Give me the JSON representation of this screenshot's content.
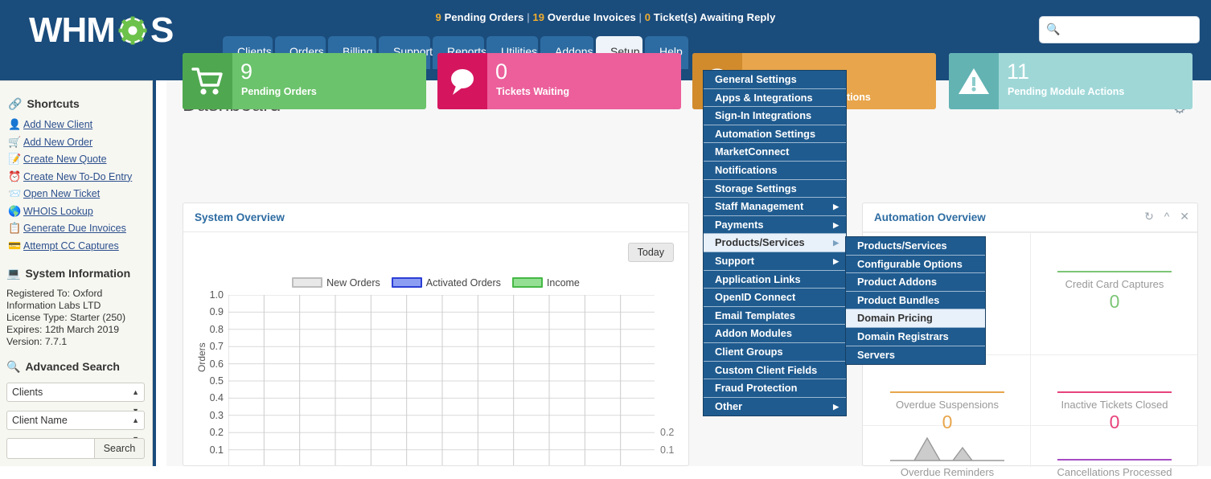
{
  "header": {
    "logo_text": "WHM",
    "logo_text2": "S",
    "notifications": {
      "pending_orders_count": "9",
      "pending_orders_label": "Pending Orders",
      "overdue_invoices_count": "19",
      "overdue_invoices_label": "Overdue Invoices",
      "tickets_count": "0",
      "tickets_label": "Ticket(s) Awaiting Reply",
      "separator": "|"
    },
    "search_placeholder": "",
    "search_value": ""
  },
  "nav": {
    "tabs": [
      {
        "label": "Clients",
        "active": false
      },
      {
        "label": "Orders",
        "active": false
      },
      {
        "label": "Billing",
        "active": false
      },
      {
        "label": "Support",
        "active": false
      },
      {
        "label": "Reports",
        "active": false
      },
      {
        "label": "Utilities",
        "active": false
      },
      {
        "label": "Addons",
        "active": false
      },
      {
        "label": "Setup",
        "active": true
      },
      {
        "label": "Help",
        "active": false
      }
    ]
  },
  "setup_menu": {
    "items": [
      {
        "label": "General Settings",
        "has_submenu": false,
        "hover": false
      },
      {
        "label": "Apps & Integrations",
        "has_submenu": false,
        "hover": false
      },
      {
        "label": "Sign-In Integrations",
        "has_submenu": false,
        "hover": false
      },
      {
        "label": "Automation Settings",
        "has_submenu": false,
        "hover": false
      },
      {
        "label": "MarketConnect",
        "has_submenu": false,
        "hover": false
      },
      {
        "label": "Notifications",
        "has_submenu": false,
        "hover": false
      },
      {
        "label": "Storage Settings",
        "has_submenu": false,
        "hover": false
      },
      {
        "label": "Staff Management",
        "has_submenu": true,
        "hover": false
      },
      {
        "label": "Payments",
        "has_submenu": true,
        "hover": false
      },
      {
        "label": "Products/Services",
        "has_submenu": true,
        "hover": true
      },
      {
        "label": "Support",
        "has_submenu": true,
        "hover": false
      },
      {
        "label": "Application Links",
        "has_submenu": false,
        "hover": false
      },
      {
        "label": "OpenID Connect",
        "has_submenu": false,
        "hover": false
      },
      {
        "label": "Email Templates",
        "has_submenu": false,
        "hover": false
      },
      {
        "label": "Addon Modules",
        "has_submenu": false,
        "hover": false
      },
      {
        "label": "Client Groups",
        "has_submenu": false,
        "hover": false
      },
      {
        "label": "Custom Client Fields",
        "has_submenu": false,
        "hover": false
      },
      {
        "label": "Fraud Protection",
        "has_submenu": false,
        "hover": false
      },
      {
        "label": "Other",
        "has_submenu": true,
        "hover": false
      }
    ]
  },
  "products_submenu": {
    "items": [
      {
        "label": "Products/Services",
        "hover": false
      },
      {
        "label": "Configurable Options",
        "hover": false
      },
      {
        "label": "Product Addons",
        "hover": false
      },
      {
        "label": "Product Bundles",
        "hover": false
      },
      {
        "label": "Domain Pricing",
        "hover": true
      },
      {
        "label": "Domain Registrars",
        "hover": false
      },
      {
        "label": "Servers",
        "hover": false
      }
    ]
  },
  "sidebar": {
    "shortcuts_title": "Shortcuts",
    "shortcuts_icon": "link-icon",
    "shortcuts": [
      {
        "label": "Add New Client",
        "icon": "add-user-icon"
      },
      {
        "label": "Add New Order",
        "icon": "add-cart-icon"
      },
      {
        "label": "Create New Quote",
        "icon": "quote-icon"
      },
      {
        "label": "Create New To-Do Entry",
        "icon": "clock-icon"
      },
      {
        "label": "Open New Ticket",
        "icon": "ticket-icon"
      },
      {
        "label": "WHOIS Lookup",
        "icon": "globe-icon"
      },
      {
        "label": "Generate Due Invoices",
        "icon": "invoice-icon"
      },
      {
        "label": "Attempt CC Captures",
        "icon": "creditcard-icon"
      }
    ],
    "system_info_title": "System Information",
    "system_info_icon": "monitor-icon",
    "system_info": [
      "Registered To: Oxford Information Labs LTD",
      "License Type: Starter (250)",
      "Expires: 12th March 2019",
      "Version: 7.7.1"
    ],
    "advanced_search_title": "Advanced Search",
    "advanced_search_icon": "magnifier-icon",
    "search_type": "Clients",
    "search_field": "Client Name",
    "search_value": "",
    "search_button": "Search"
  },
  "main": {
    "page_title": "Dashboard",
    "settings_icon": "gear-icon",
    "cards": [
      {
        "value": "9",
        "label": "Pending Orders",
        "icon": "cart-icon",
        "bg": "#6bc36b",
        "icon_bg": "#4fa84f"
      },
      {
        "value": "0",
        "label": "Tickets Waiting",
        "icon": "chat-icon",
        "bg": "#ec5f9b",
        "icon_bg": "#d5165f"
      },
      {
        "value": "",
        "label": "ations",
        "icon": "clock-icon",
        "bg": "#e8a54b",
        "icon_bg": "#d18b2d"
      },
      {
        "value": "11",
        "label": "Pending Module Actions",
        "icon": "warning-icon",
        "bg": "#9fd7d7",
        "icon_bg": "#63b3b3"
      }
    ]
  },
  "system_overview": {
    "title": "System Overview",
    "today_button": "Today"
  },
  "chart_data": {
    "type": "line",
    "title": "System Overview",
    "xlabel": "",
    "ylabel": "Orders",
    "ylim": [
      0.0,
      1.0
    ],
    "yticks": [
      "1.0",
      "0.9",
      "0.8",
      "0.7",
      "0.6",
      "0.5",
      "0.4",
      "0.3",
      "0.2",
      "0.1"
    ],
    "y2ticks": [
      "0.2",
      "0.1"
    ],
    "grid": true,
    "legend_position": "top",
    "series": [
      {
        "name": "New Orders",
        "color": "#e8e8e8",
        "border": "#bdbdbd",
        "values": []
      },
      {
        "name": "Activated Orders",
        "color": "#8c9ef2",
        "border": "#2c3fd6",
        "values": []
      },
      {
        "name": "Income",
        "color": "#95df95",
        "border": "#45b845",
        "values": []
      }
    ]
  },
  "automation_overview": {
    "title": "Automation Overview",
    "tools": [
      "refresh-icon",
      "collapse-icon",
      "close-icon"
    ],
    "metrics": [
      {
        "label": "",
        "value": "",
        "color": "#7cc576",
        "sparkline": "line",
        "hidden": true
      },
      {
        "label": "Credit Card Captures",
        "value": "0",
        "color": "#7cc576",
        "sparkline": "line"
      },
      {
        "label": "Overdue Suspensions",
        "value": "0",
        "color": "#e8a54b",
        "sparkline": "line"
      },
      {
        "label": "Inactive Tickets Closed",
        "value": "0",
        "color": "#e8437c",
        "sparkline": "line"
      },
      {
        "label": "Overdue Reminders",
        "value": "",
        "color": "#bdbdbd",
        "sparkline": "peaks"
      },
      {
        "label": "Cancellations Processed",
        "value": "",
        "color": "#a74bc4",
        "sparkline": "line"
      }
    ]
  }
}
